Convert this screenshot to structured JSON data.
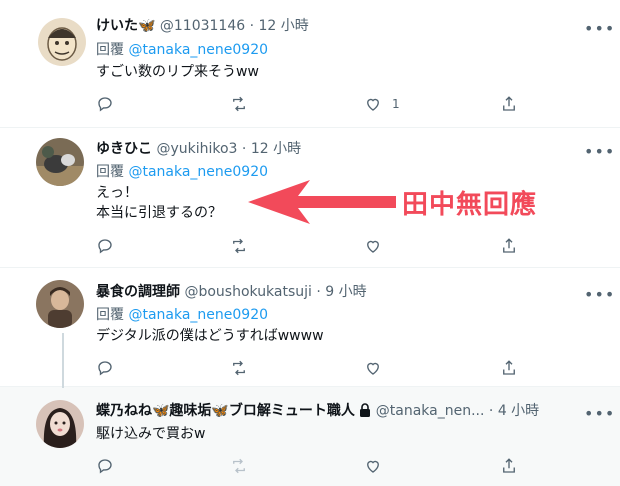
{
  "colors": {
    "link": "#1d9bf0",
    "secondary": "#536471",
    "annotation": "#f24a5a"
  },
  "tweets": [
    {
      "name": "けいた",
      "badge_icon": "butterfly-icon",
      "handle": "@11031146",
      "time": "12 小時",
      "reply_prefix": "回覆",
      "mention": "@tanaka_nene0920",
      "lines": [
        "すごい数のリプ来そうww"
      ],
      "like_count": "1"
    },
    {
      "name": "ゆきひこ",
      "handle": "@yukihiko3",
      "time": "12 小時",
      "reply_prefix": "回覆",
      "mention": "@tanaka_nene0920",
      "lines": [
        "えっ！",
        "本当に引退するの？"
      ],
      "like_count": ""
    },
    {
      "name": "暴食の調理師",
      "handle": "@boushokukatsuji",
      "time": "9 小時",
      "reply_prefix": "回覆",
      "mention": "@tanaka_nene0920",
      "lines": [
        "デジタル派の僕はどうすればwwww"
      ],
      "like_count": ""
    },
    {
      "name": "蝶乃ねね🦋趣味垢🦋ブロ解ミュート職人",
      "lock_icon": "lock-icon",
      "handle": "@tanaka_nen...",
      "time": "4 小時",
      "lines": [
        "駆け込みで買おw"
      ],
      "like_count": ""
    }
  ],
  "annotation": {
    "text": "田中無回應"
  }
}
